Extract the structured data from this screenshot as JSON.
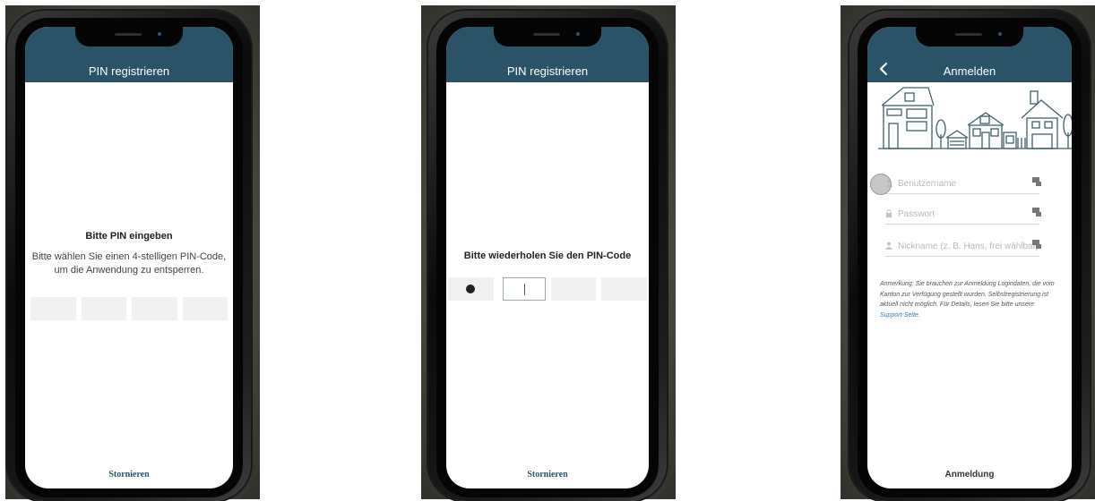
{
  "screen1": {
    "header_title": "PIN registrieren",
    "prompt_title": "Bitte PIN eingeben",
    "prompt_description": "Bitte wählen Sie einen 4-stelligen PIN-Code, um die Anwendung zu entsperren.",
    "pin_digits_entered": 0,
    "pin_length": 4,
    "footer": "Stornieren"
  },
  "screen2": {
    "header_title": "PIN registrieren",
    "prompt_title": "Bitte wiederholen Sie den PIN-Code",
    "pin_digits_entered": 1,
    "pin_length": 4,
    "footer": "Stornieren"
  },
  "screen3": {
    "header_title": "Anmelden",
    "back_icon": "chevron-left-icon",
    "fields": [
      {
        "icon": "user-icon",
        "placeholder": "Benutzername"
      },
      {
        "icon": "lock-icon",
        "placeholder": "Passwort"
      },
      {
        "icon": "user-icon",
        "placeholder": "Nickname (z. B. Hans, frei wählbar)"
      }
    ],
    "note_text": "Anmerkung: Sie brauchen zur Anmeldung Logindaten, die vom Kanton zur Verfügung gestellt wurden. Selbstregistrierung ist aktuell nicht möglich. Für Details, lesen Sie bitte unsere ",
    "note_link": "Support-Seite",
    "note_end": ".",
    "footer": "Anmeldung"
  },
  "colors": {
    "header": "#2a5367",
    "link": "#3a78b0"
  }
}
